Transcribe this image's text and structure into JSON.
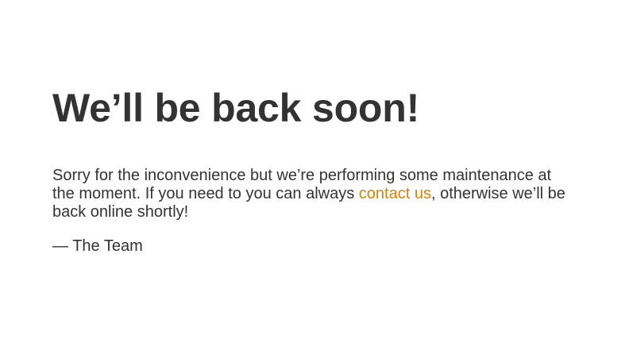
{
  "page": {
    "title": "We’ll be back soon!",
    "message_before_link": "Sorry for the inconvenience but we’re performing some maintenance at the moment. If you need to you can always ",
    "link_text": "contact us",
    "message_after_link": ", otherwise we’ll be back online shortly!",
    "signature": "— The Team"
  },
  "colors": {
    "text": "#333333",
    "link": "#dc8100",
    "background": "#ffffff"
  }
}
